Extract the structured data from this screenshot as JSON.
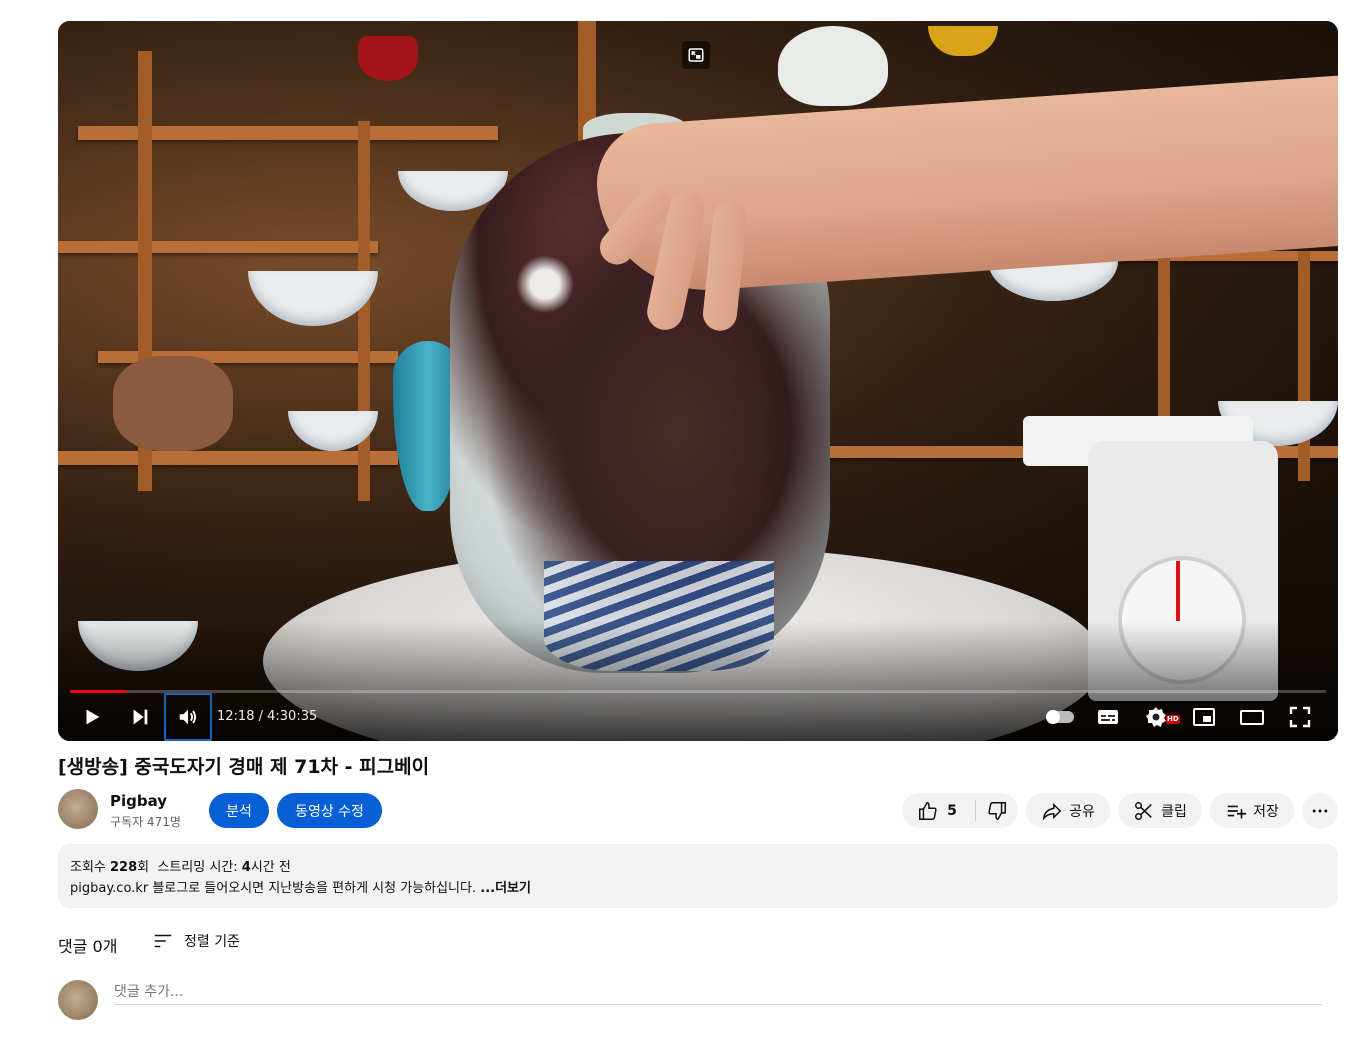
{
  "player": {
    "current_time": "12:18",
    "time_separator": " / ",
    "duration": "4:30:35",
    "progress_fraction": 0.0454,
    "hd_badge": "HD",
    "icons": [
      "exit-mini-player-icon",
      "play-icon",
      "next-icon",
      "volume-icon",
      "autoplay-toggle-icon",
      "subtitles-icon",
      "settings-icon",
      "miniplayer-icon",
      "theater-icon",
      "fullscreen-icon"
    ]
  },
  "video": {
    "title": "[생방송] 중국도자기 경매 제 71차 - 피그베이"
  },
  "channel": {
    "name": "Pigbay",
    "subscribers": "구독자 471명"
  },
  "actions": {
    "analytics_label": "분석",
    "edit_label": "동영상 수정",
    "like_count": "5",
    "share_label": "공유",
    "clip_label": "클립",
    "save_label": "저장"
  },
  "description": {
    "views_prefix": "조회수 ",
    "views_count": "228",
    "views_suffix": "회  스트리밍 시간: ",
    "stream_hours": "4",
    "stream_suffix": "시간 전",
    "text": "pigbay.co.kr 블로그로 들어오시면 지난방송을 편하게 시청 가능하십니다. ",
    "more": "...더보기"
  },
  "comments": {
    "count_label": "댓글 0개",
    "sort_label": "정렬 기준",
    "input_placeholder": "댓글 추가..."
  },
  "colors": {
    "accent_blue": "#065fd4",
    "progress_red": "#ff0000",
    "chip_grey": "#f2f2f2"
  }
}
